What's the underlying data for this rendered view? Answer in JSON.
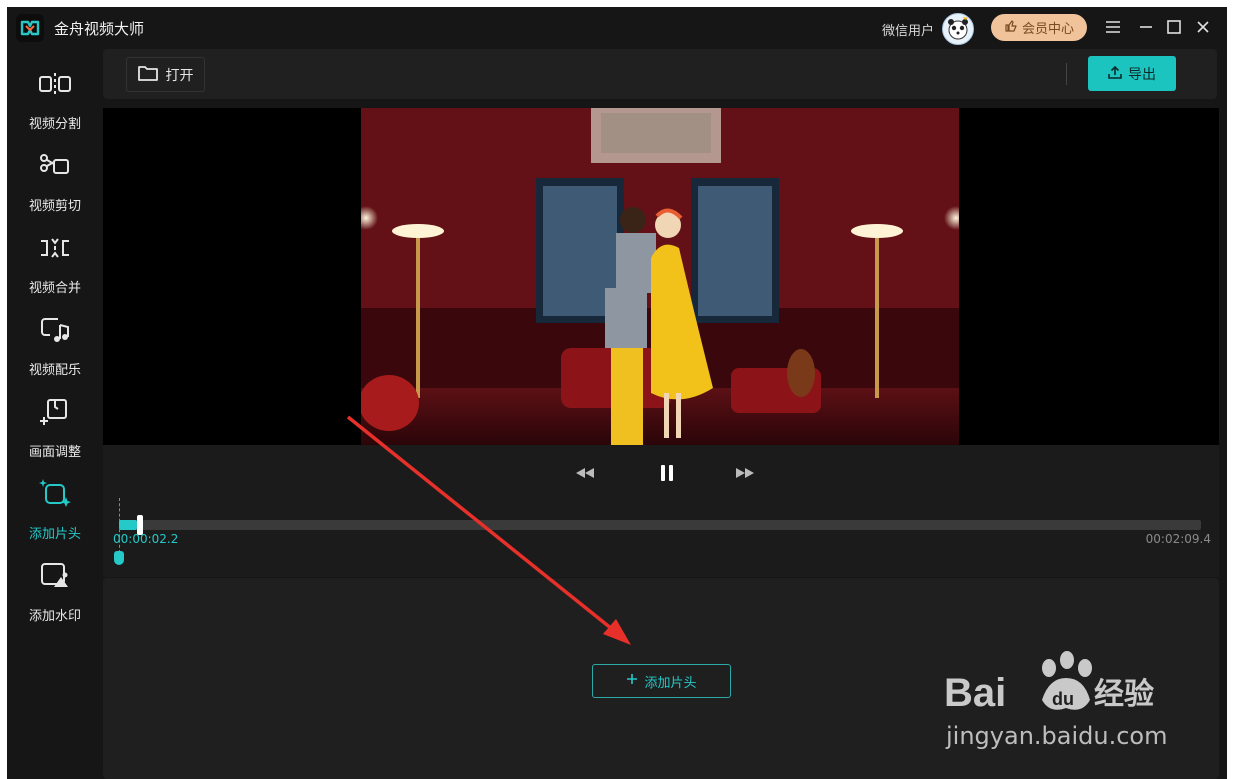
{
  "titlebar": {
    "app_title": "金舟视频大师",
    "user_name": "微信用户",
    "vip_label": "会员中心",
    "menu_icon": "hamburger-icon",
    "minimize_icon": "minimize-icon",
    "maximize_icon": "maximize-icon",
    "close_icon": "close-icon"
  },
  "sidebar": {
    "items": [
      {
        "label": "视频分割",
        "icon": "split-icon"
      },
      {
        "label": "视频剪切",
        "icon": "scissors-icon"
      },
      {
        "label": "视频合并",
        "icon": "merge-icon"
      },
      {
        "label": "视频配乐",
        "icon": "music-icon"
      },
      {
        "label": "画面调整",
        "icon": "crop-icon"
      },
      {
        "label": "添加片头",
        "icon": "sparkle-frame-icon",
        "active": true
      },
      {
        "label": "添加水印",
        "icon": "image-watermark-icon"
      }
    ]
  },
  "toolbar": {
    "open_label": "打开",
    "export_label": "导出"
  },
  "player": {
    "rewind_icon": "rewind-icon",
    "pause_icon": "pause-icon",
    "forward_icon": "fast-forward-icon",
    "current_time": "00:00:02.2",
    "total_time": "00:02:09.4",
    "progress": 0.017
  },
  "bottom_panel": {
    "add_intro_label": "添加片头"
  },
  "watermark": {
    "brand_text": "Bai du 经验",
    "domain": "jingyan.baidu.com"
  },
  "colors": {
    "accent": "#25c9c7",
    "background": "#161616",
    "panel": "#1f1f1f",
    "vip": "#f0c39a",
    "annotation_arrow": "#e8302a"
  }
}
